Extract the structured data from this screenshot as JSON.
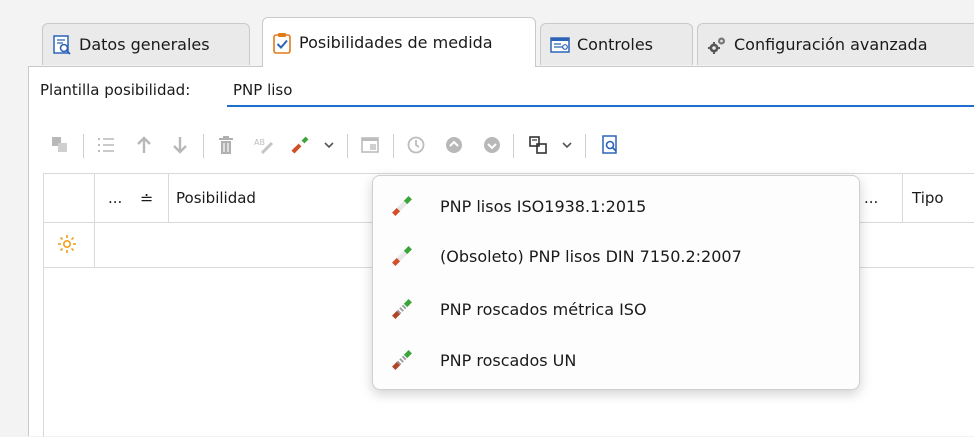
{
  "tabs": [
    {
      "label": "Datos generales",
      "icon": "document-magnifier-icon",
      "active": false
    },
    {
      "label": "Posibilidades de medida",
      "icon": "clipboard-check-icon",
      "active": true
    },
    {
      "label": "Controles",
      "icon": "controls-list-icon",
      "active": false
    },
    {
      "label": "Configuración avanzada",
      "icon": "gears-icon",
      "active": false
    }
  ],
  "template": {
    "label": "Plantilla posibilidad:",
    "value": "PNP liso"
  },
  "toolbar": {
    "icons": [
      "copy-icon",
      "numbered-list-icon",
      "move-up-icon",
      "move-down-icon",
      "delete-icon",
      "rename-icon",
      "add-pnp-icon",
      "dropdown-arrow-icon",
      "window-icon",
      "history-icon",
      "circle-up-icon",
      "circle-down-icon",
      "export-icon",
      "dropdown-arrow-icon",
      "preview-icon"
    ]
  },
  "grid": {
    "columns": {
      "ellipsis": "...",
      "sort": "≐",
      "posibilidad": "Posibilidad",
      "truncated": "...",
      "tipo": "Tipo"
    }
  },
  "menu": {
    "items": [
      {
        "label": "PNP lisos ISO1938.1:2015"
      },
      {
        "label": "(Obsoleto) PNP lisos DIN 7150.2:2007"
      },
      {
        "label": "PNP roscados métrica ISO"
      },
      {
        "label": "PNP roscados UN"
      }
    ]
  },
  "colors": {
    "accent": "#1f6fd0",
    "pnp_green": "#3aa63a",
    "pnp_red": "#d0502a",
    "new_row_sun": "#f0a020"
  }
}
